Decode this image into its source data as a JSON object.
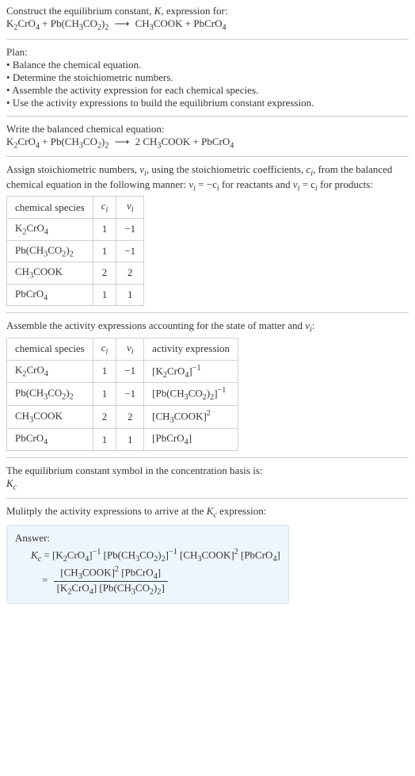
{
  "header": {
    "title_prefix": "Construct the equilibrium constant, ",
    "title_k": "K",
    "title_suffix": ", expression for:"
  },
  "plan": {
    "heading": "Plan:",
    "items": [
      "Balance the chemical equation.",
      "Determine the stoichiometric numbers.",
      "Assemble the activity expression for each chemical species.",
      "Use the activity expressions to build the equilibrium constant expression."
    ]
  },
  "balanced_heading": "Write the balanced chemical equation:",
  "stoich_text": {
    "prefix": "Assign stoichiometric numbers, ",
    "nu": "ν",
    "sub_i": "i",
    "mid1": ", using the stoichiometric coefficients, ",
    "c": "c",
    "mid2": ", from the balanced chemical equation in the following manner: ",
    "eq1_lhs": "ν",
    "eq1_rhs": " = −c",
    "mid3": " for reactants and ",
    "eq2": " = c",
    "suffix": " for products:"
  },
  "table1": {
    "headers": [
      "chemical species",
      "cᵢ",
      "νᵢ"
    ],
    "rows": [
      {
        "species": "K2CrO4",
        "c": "1",
        "nu": "−1"
      },
      {
        "species": "Pb(CH3CO2)2",
        "c": "1",
        "nu": "−1"
      },
      {
        "species": "CH3COOK",
        "c": "2",
        "nu": "2"
      },
      {
        "species": "PbCrO4",
        "c": "1",
        "nu": "1"
      }
    ]
  },
  "assemble_text": {
    "prefix": "Assemble the activity expressions accounting for the state of matter and ",
    "suffix": ":"
  },
  "table2": {
    "headers": [
      "chemical species",
      "cᵢ",
      "νᵢ",
      "activity expression"
    ],
    "rows": [
      {
        "species": "K2CrO4",
        "c": "1",
        "nu": "−1",
        "act": "[K2CrO4]^-1"
      },
      {
        "species": "Pb(CH3CO2)2",
        "c": "1",
        "nu": "−1",
        "act": "[Pb(CH3CO2)2]^-1"
      },
      {
        "species": "CH3COOK",
        "c": "2",
        "nu": "2",
        "act": "[CH3COOK]^2"
      },
      {
        "species": "PbCrO4",
        "c": "1",
        "nu": "1",
        "act": "[PbCrO4]"
      }
    ]
  },
  "basis_text": "The equilibrium constant symbol in the concentration basis is:",
  "kc": "K",
  "kc_sub": "c",
  "multiply_text_prefix": "Mulitply the activity expressions to arrive at the ",
  "multiply_text_suffix": " expression:",
  "answer": {
    "label": "Answer:",
    "eq_prefix": " = "
  },
  "chart_data": {
    "type": "table",
    "tables": [
      {
        "title": "Stoichiometric numbers",
        "columns": [
          "chemical species",
          "c_i",
          "nu_i"
        ],
        "rows": [
          [
            "K2CrO4",
            1,
            -1
          ],
          [
            "Pb(CH3CO2)2",
            1,
            -1
          ],
          [
            "CH3COOK",
            2,
            2
          ],
          [
            "PbCrO4",
            1,
            1
          ]
        ]
      },
      {
        "title": "Activity expressions",
        "columns": [
          "chemical species",
          "c_i",
          "nu_i",
          "activity expression"
        ],
        "rows": [
          [
            "K2CrO4",
            1,
            -1,
            "[K2CrO4]^-1"
          ],
          [
            "Pb(CH3CO2)2",
            1,
            -1,
            "[Pb(CH3CO2)2]^-1"
          ],
          [
            "CH3COOK",
            2,
            2,
            "[CH3COOK]^2"
          ],
          [
            "PbCrO4",
            1,
            1,
            "[PbCrO4]"
          ]
        ]
      }
    ]
  }
}
